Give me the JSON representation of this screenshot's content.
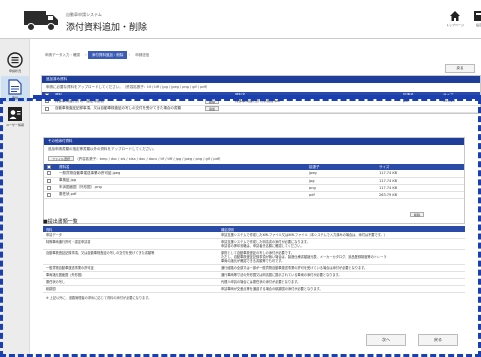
{
  "header": {
    "app_subtitle": "自動車申請システム",
    "title": "添付資料追加・削除",
    "top_button": "トップページ",
    "settings_button": "設定"
  },
  "sidebar": {
    "items": [
      {
        "label": "申請状況"
      },
      {
        "label": "申請"
      },
      {
        "label": "ユーザー情報"
      }
    ]
  },
  "steps": [
    {
      "label": "申請データ入力・確認"
    },
    {
      "label": "添付資料追加・削除"
    },
    {
      "label": "申請送信"
    }
  ],
  "top_back_button": "戻る",
  "attached_panel": {
    "header": "追加済み資料",
    "note": "申請に必要な資料をアップロードしてください。（許容拡張子：tif / tiff / jpg / jpeg / png / gif / pdf）",
    "columns": [
      "資料",
      "資料名",
      "拡張子",
      "サイズ"
    ],
    "rows": [
      {
        "name": "特殊車両通行許可・認定申請書",
        "action": "削除",
        "file": "特殊車両通行許可申請書.pdf",
        "ext": "pdf",
        "size": "593.27"
      },
      {
        "name": "自動車検査証記録事項、又は自動車検査証の写しの交付を受けてきた場合の書類",
        "action": "追加",
        "file": "",
        "ext": "",
        "size": ""
      }
    ]
  },
  "upload_panel": {
    "header": "その他添付資料",
    "note": "追加申請書類の指定等書類以外の資料をアップロードしてください。",
    "select_button": "ファイル選択",
    "allowed": "（許容拡張子：bmp / dxc / xls / xlsx / doc / docx / tif / tiff / jpg / jpeg / png / gif / pdf）",
    "columns": [
      "資料名",
      "拡張子",
      "サイズ"
    ],
    "rows": [
      {
        "file": "一般貨物自動車運送事業の許可証.jpeg",
        "ext": "jpeg",
        "size": "117.74 KB"
      },
      {
        "file": "車検証.jpg",
        "ext": "jpg",
        "size": "117.74 KB"
      },
      {
        "file": "车诉図面図（外形図）.png",
        "ext": "png",
        "size": "117.74 KB"
      },
      {
        "file": "委任状.pdf",
        "ext": "pdf",
        "size": "263.79 KB"
      }
    ],
    "delete_button": "削除"
  },
  "list_section": {
    "title": "■提出書類一覧",
    "columns": [
      "資料",
      "補足説明"
    ],
    "rows": [
      {
        "name": "申請データ",
        "desc": [
          "申請支援システムで作成したXMLファイル又はXMLファイル（本システムで入力済みの場合は、添付は不要です。）"
        ]
      },
      {
        "name": "特殊車両通行許可・認定申請書",
        "desc": [
          "申請支援システムで作成した申請書の添付が必要になります。",
          "申請書の押印省略は、申請者氏名欄に確認してください。"
        ]
      },
      {
        "name": "自動車検査証記録事項、又は自動車検査証の写しの交付を受けてきた書類等",
        "desc": [
          "原則として自動車検査証の写しの添付が必要です。",
          "ただし、自動車検査証記録事項が無い場合は、製造仕様書類諸元表、メーカーカタログ、景品登録制度等のトレーラ",
          "車両の諸元が確認できる書類等でも可です。"
        ]
      },
      {
        "name": "一般貨物自動車運送事業の許可証",
        "desc": [
          "通行経路の全部又は一部が一般貨物自動車運送事業の許可を受けている場合は添付が必要となります。"
        ]
      },
      {
        "name": "車両諸元図面図（外形図）",
        "desc": [
          "通行車両等寸法の外形図又は申請図に図示されている車両の添付が必要となります。"
        ]
      },
      {
        "name": "委任状の写し",
        "desc": [
          "代理人申請の場合には委任状の添付が必要となります。"
        ]
      },
      {
        "name": "軌跡図",
        "desc": [
          "申請車両が交差点等を通過する場合の軌跡図の添付が必要となります。"
        ]
      }
    ],
    "footnote": "※ 上記以外に、道路管理者の求めに応じて資料の添付が必要になります。"
  },
  "footer": {
    "next_button": "次へ",
    "back_button": "戻る"
  },
  "colors": {
    "accent": "#2a4ca8",
    "highlight": "#1a3fb0"
  }
}
